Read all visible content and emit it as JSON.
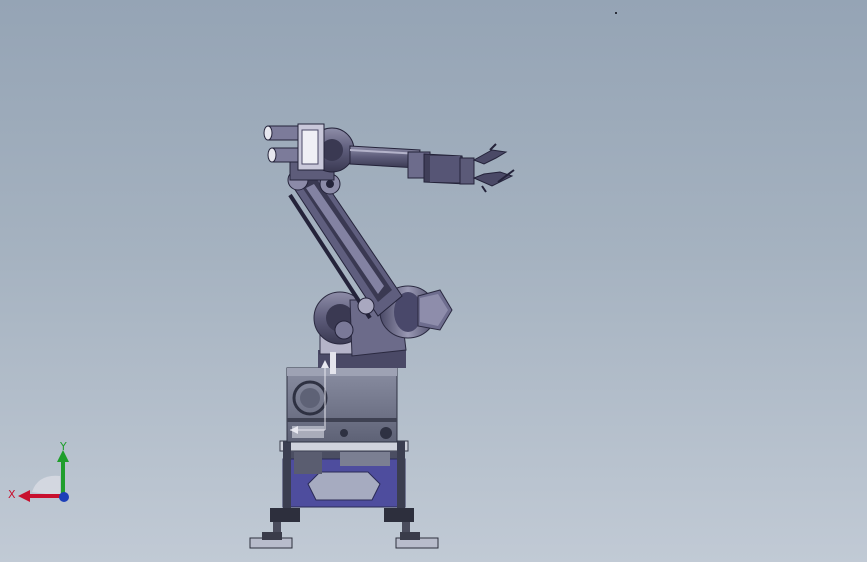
{
  "viewport": {
    "background_top": "#95a4b5",
    "background_bottom": "#c1cad5"
  },
  "model": {
    "body_color": "#6b6a8a",
    "dark_color": "#33324a",
    "light_color": "#b9b8cc",
    "base_color": "#767a8e",
    "stand_panel_color": "#4e4d9e"
  },
  "triad": {
    "x_label": "X",
    "y_label": "Y",
    "x_color": "#c8102e",
    "y_color": "#1f9e2c",
    "z_color": "#1c3fb8"
  }
}
